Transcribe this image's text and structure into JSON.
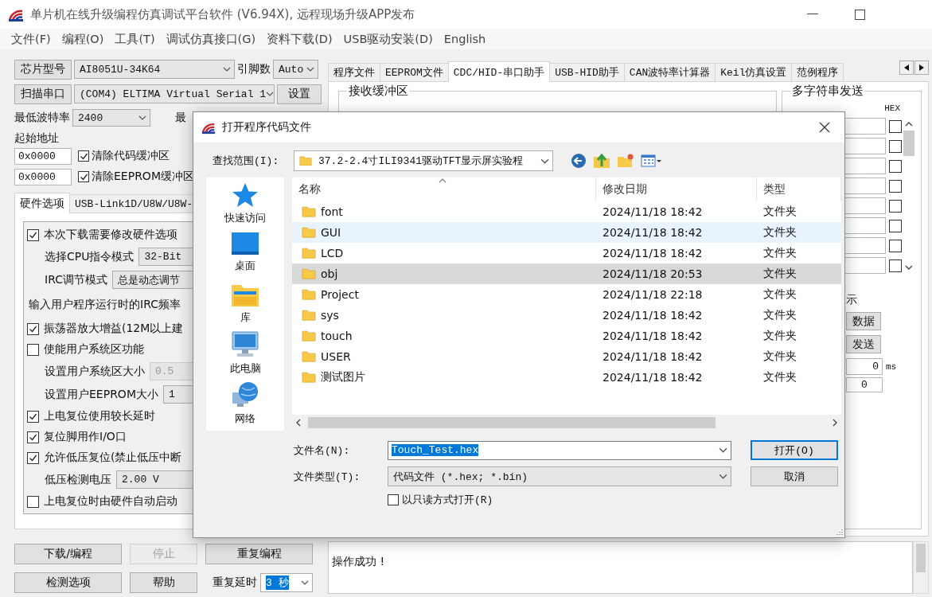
{
  "window": {
    "title": "单片机在线升级编程仿真调试平台软件 (V6.94X), 远程现场升级APP发布"
  },
  "menu": [
    "文件(F)",
    "编程(O)",
    "工具(T)",
    "调试仿真接口(G)",
    "资料下载(D)",
    "USB驱动安装(D)",
    "English"
  ],
  "left": {
    "chip_button": "芯片型号",
    "chip": "AI8051U-34K64",
    "pins_label": "引脚数",
    "pins": "Auto",
    "scan_button": "扫描串口",
    "port": "(COM4) ELTIMA Virtual Serial 1",
    "settings_button": "设置",
    "min_baud_label": "最低波特率",
    "min_baud": "2400",
    "max_baud_label": "最",
    "start_address_label": "起始地址",
    "address_rows": [
      {
        "address": "0x0000",
        "label": "清除代码缓冲区",
        "checked": true
      },
      {
        "address": "0x0000",
        "label": "清除EEPROM缓冲区",
        "checked": true
      }
    ],
    "tabs": [
      {
        "label": "硬件选项",
        "selected": true
      },
      {
        "label": "USB-Link1D/U8W/U8W-",
        "selected": false
      }
    ],
    "options": [
      {
        "kind": "check",
        "label": "本次下载需要修改硬件选项",
        "checked": true
      },
      {
        "kind": "select",
        "label": "选择CPU指令模式",
        "value": "32-Bit",
        "disabled": false
      },
      {
        "kind": "select",
        "label": "IRC调节模式",
        "value": "总是动态调节",
        "disabled": false
      },
      {
        "kind": "text",
        "label": "输入用户程序运行时的IRC频率"
      },
      {
        "kind": "check",
        "label": "振荡器放大增益(12M以上建",
        "checked": true
      },
      {
        "kind": "check",
        "label": "使能用户系统区功能",
        "checked": false
      },
      {
        "kind": "select",
        "label": "设置用户系统区大小",
        "value": "0.5",
        "disabled": true
      },
      {
        "kind": "select",
        "label": "设置用户EEPROM大小",
        "value": "1",
        "disabled": false
      },
      {
        "kind": "check",
        "label": "上电复位使用较长延时",
        "checked": true
      },
      {
        "kind": "check",
        "label": "复位脚用作I/O口",
        "checked": true
      },
      {
        "kind": "check",
        "label": "允许低压复位(禁止低压中断",
        "checked": true
      },
      {
        "kind": "select",
        "label": "低压检测电压",
        "value": "2.00 V",
        "disabled": false
      },
      {
        "kind": "check",
        "label": "上电复位时由硬件自动启动",
        "checked": false
      }
    ],
    "buttons": [
      {
        "label": "下载/编程",
        "disabled": false
      },
      {
        "label": "停止",
        "disabled": true
      },
      {
        "label": "重复编程",
        "disabled": false
      },
      {
        "label": "检测选项",
        "disabled": false
      },
      {
        "label": "帮助",
        "disabled": false
      }
    ],
    "repeat_delay": {
      "label": "重复延时",
      "value": "3 秒",
      "highlighted": true
    }
  },
  "right": {
    "tabs": [
      {
        "label": "程序文件",
        "selected": false
      },
      {
        "label": "EEPROM文件",
        "selected": false
      },
      {
        "label": "CDC/HID-串口助手",
        "selected": true
      },
      {
        "label": "USB-HID助手",
        "selected": false
      },
      {
        "label": "CAN波特率计算器",
        "selected": false
      },
      {
        "label": "Keil仿真设置",
        "selected": false
      },
      {
        "label": "范例程序",
        "selected": false
      }
    ],
    "receive_title": "接收缓冲区",
    "multi_send": {
      "title": "多字符串发送",
      "hex_label": "HEX",
      "rows": [
        {
          "hex": false
        },
        {
          "hex": false
        },
        {
          "hex": false
        },
        {
          "hex": false
        },
        {
          "hex": false
        },
        {
          "hex": false
        },
        {
          "hex": false
        },
        {
          "hex": false
        }
      ],
      "partial_label": "示",
      "buttons": [
        "数据",
        "发送"
      ],
      "interval": "0",
      "unit": "ms",
      "count": "0"
    },
    "log": "操作成功 !"
  },
  "dialog": {
    "title": "打开程序代码文件",
    "look_in_label": "查找范围(I):",
    "look_in": "37.2-2.4寸ILI9341驱动TFT显示屏实验程",
    "places": [
      {
        "kind": "quick",
        "label": "快速访问"
      },
      {
        "kind": "desktop",
        "label": "桌面"
      },
      {
        "kind": "library",
        "label": "库"
      },
      {
        "kind": "computer",
        "label": "此电脑"
      },
      {
        "kind": "network",
        "label": "网络"
      }
    ],
    "columns": [
      "名称",
      "修改日期",
      "类型"
    ],
    "files": [
      {
        "name": "font",
        "date": "2024/11/18 18:42",
        "type": "文件夹",
        "selected": false,
        "hovered": false
      },
      {
        "name": "GUI",
        "date": "2024/11/18 18:42",
        "type": "文件夹",
        "selected": false,
        "hovered": true
      },
      {
        "name": "LCD",
        "date": "2024/11/18 18:42",
        "type": "文件夹",
        "selected": false,
        "hovered": false
      },
      {
        "name": "obj",
        "date": "2024/11/18 20:53",
        "type": "文件夹",
        "selected": true,
        "hovered": false
      },
      {
        "name": "Project",
        "date": "2024/11/18 22:18",
        "type": "文件夹",
        "selected": false,
        "hovered": false
      },
      {
        "name": "sys",
        "date": "2024/11/18 18:42",
        "type": "文件夹",
        "selected": false,
        "hovered": false
      },
      {
        "name": "touch",
        "date": "2024/11/18 18:42",
        "type": "文件夹",
        "selected": false,
        "hovered": false
      },
      {
        "name": "USER",
        "date": "2024/11/18 18:42",
        "type": "文件夹",
        "selected": false,
        "hovered": false
      },
      {
        "name": "测试图片",
        "date": "2024/11/18 18:42",
        "type": "文件夹",
        "selected": false,
        "hovered": false
      }
    ],
    "filename_label": "文件名(N):",
    "filename": "Touch_Test.hex",
    "filename_highlighted": true,
    "filetype_label": "文件类型(T):",
    "filetype": "代码文件 (*.hex; *.bin)",
    "open_button": "打开(O)",
    "cancel_button": "取消",
    "readonly": {
      "label": "以只读方式打开(R)",
      "checked": false
    }
  }
}
